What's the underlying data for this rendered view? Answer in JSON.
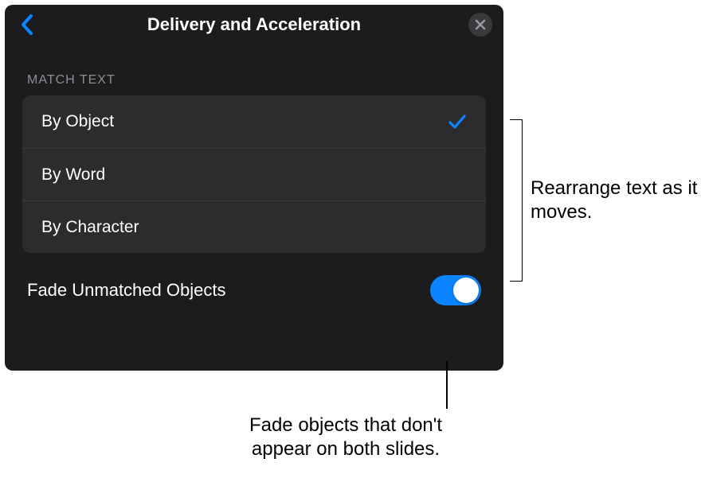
{
  "header": {
    "title": "Delivery and Acceleration"
  },
  "matchText": {
    "sectionLabel": "MATCH TEXT",
    "options": {
      "byObject": "By Object",
      "byWord": "By Word",
      "byCharacter": "By Character"
    },
    "selected": "byObject"
  },
  "fadeUnmatched": {
    "label": "Fade Unmatched Objects",
    "enabled": true
  },
  "callouts": {
    "rearrange": "Rearrange text as it moves.",
    "fade": "Fade objects that don't appear on both slides."
  }
}
